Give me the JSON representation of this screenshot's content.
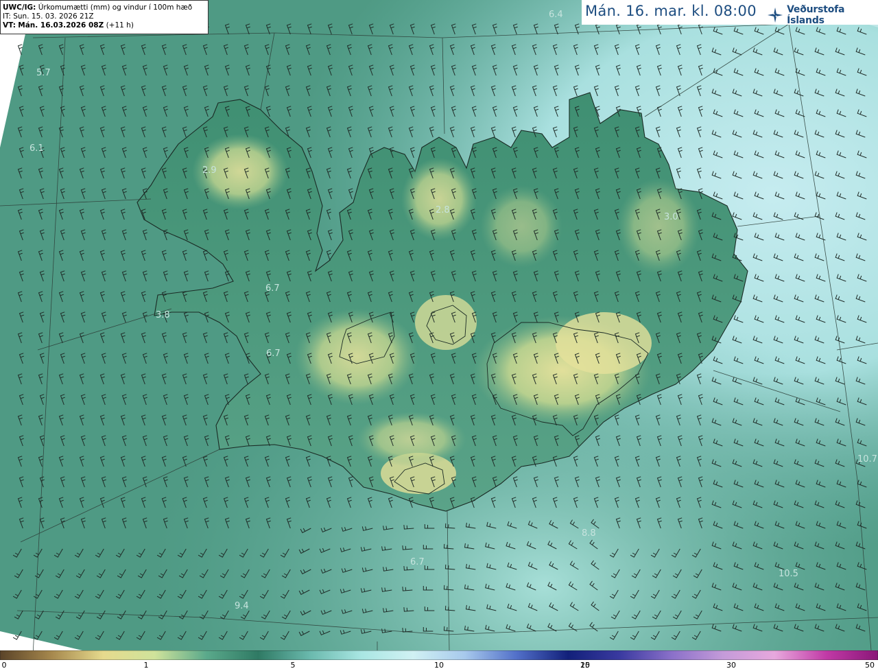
{
  "header": {
    "model_code": "UWC/IG:",
    "title": "Úrkomumætti (mm) og vindur í 100m hæð",
    "initial_time": "IT: Sun. 15. 03. 2026 21Z",
    "valid_prefix": "VT:",
    "valid_time": "Mán. 16.03.2026 08Z",
    "lead_time": "(+11 h)"
  },
  "time_label": "Mán. 16. mar. kl. 08:00",
  "brand": {
    "name": "Veðurstofa Íslands",
    "color": "#1d4d80",
    "icon": "vedurstofa-logo-icon"
  },
  "colorbar": {
    "ticks": [
      {
        "label": "0",
        "value": 0
      },
      {
        "label": "1",
        "value": 1
      },
      {
        "label": "5",
        "value": 5
      },
      {
        "label": "10",
        "value": 10
      },
      {
        "label": "15",
        "value": 15
      },
      {
        "label": "20",
        "value": 20
      },
      {
        "label": "30",
        "value": 30
      },
      {
        "label": "50",
        "value": 50
      }
    ],
    "colors": [
      "#5a4328",
      "#a6884d",
      "#e6da8d",
      "#cfe39b",
      "#5aa98b",
      "#2f7a64",
      "#6ab9ad",
      "#a9e6e3",
      "#d0f1f3",
      "#a7c9ec",
      "#5270c9",
      "#12207a",
      "#3a3aa0",
      "#8a70c9",
      "#c49bd9",
      "#e7a8dd",
      "#c13aa6",
      "#8a1778"
    ]
  },
  "map_labels": [
    {
      "text": "6.4"
    },
    {
      "text": "5.7"
    },
    {
      "text": "6.1"
    },
    {
      "text": "2.9"
    },
    {
      "text": "2.8"
    },
    {
      "text": "3.0"
    },
    {
      "text": "6.7"
    },
    {
      "text": "3.8"
    },
    {
      "text": "6.7"
    },
    {
      "text": "8.8"
    },
    {
      "text": "6.7"
    },
    {
      "text": "10.5"
    },
    {
      "text": "9.4"
    },
    {
      "text": "10.7"
    }
  ]
}
